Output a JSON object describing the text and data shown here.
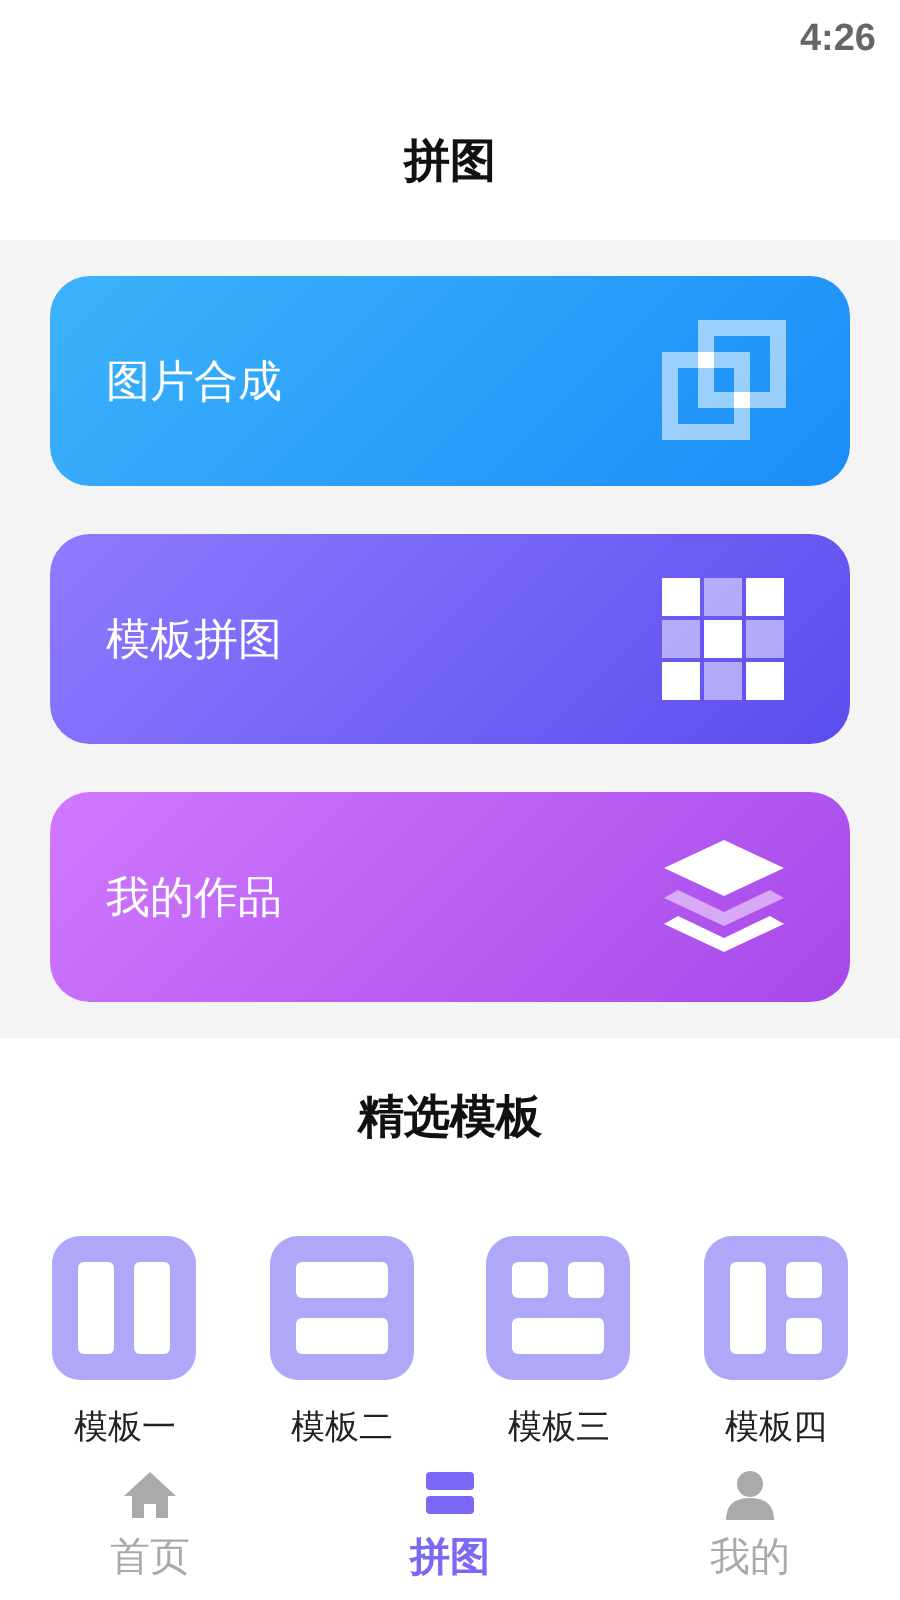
{
  "status_bar": {
    "time": "4:26"
  },
  "header": {
    "title": "拼图"
  },
  "actions": [
    {
      "label": "图片合成",
      "kind": "merge"
    },
    {
      "label": "模板拼图",
      "kind": "grid"
    },
    {
      "label": "我的作品",
      "kind": "layers"
    }
  ],
  "templates": {
    "title": "精选模板",
    "items": [
      {
        "label": "模板一",
        "kind": "columns"
      },
      {
        "label": "模板二",
        "kind": "rows"
      },
      {
        "label": "模板三",
        "kind": "mixed"
      },
      {
        "label": "模板四",
        "kind": "side"
      }
    ]
  },
  "tab_bar": [
    {
      "label": "首页",
      "kind": "home",
      "selected": false
    },
    {
      "label": "拼图",
      "kind": "puzzle",
      "selected": true
    },
    {
      "label": "我的",
      "kind": "profile",
      "selected": false
    }
  ]
}
